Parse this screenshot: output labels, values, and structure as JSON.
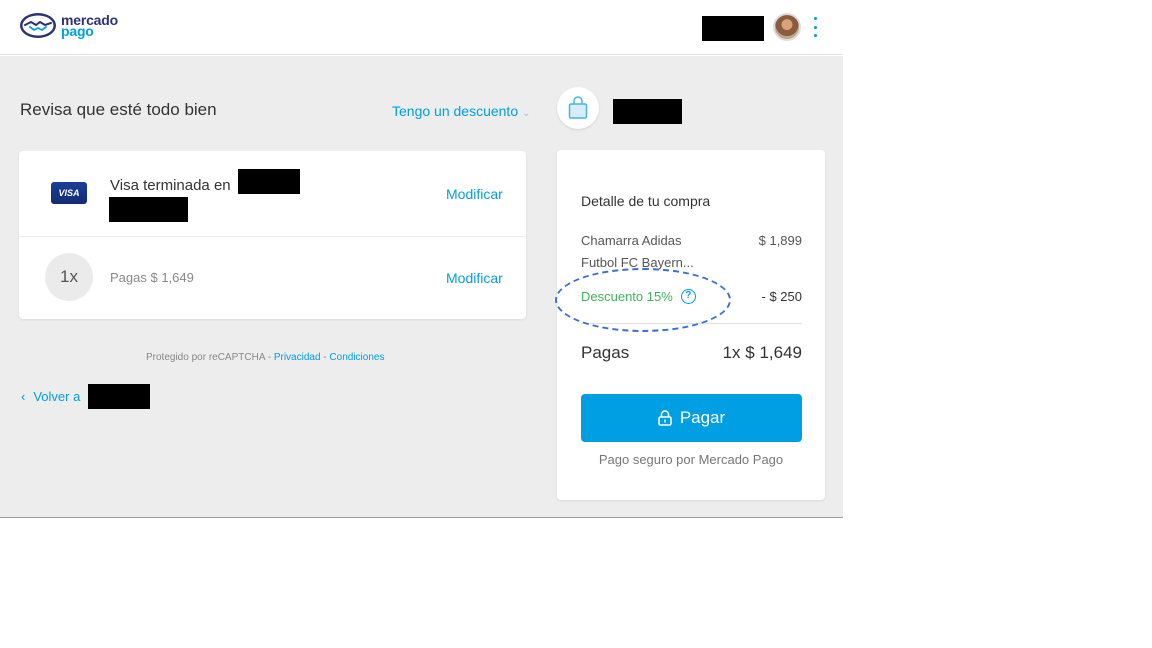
{
  "header": {
    "logo": {
      "line1": "mercado",
      "line2": "pago"
    }
  },
  "review": {
    "title": "Revisa que esté todo bien",
    "discount_link": "Tengo un descuento",
    "chevron": "⌄"
  },
  "payment_card": {
    "brand": "VISA",
    "card_text": "Visa terminada en",
    "modify_label": "Modificar",
    "installments": "1x",
    "installments_text": "Pagas $ 1,649",
    "modify_label_2": "Modificar"
  },
  "footer": {
    "protected_prefix": "Protegido por reCAPTCHA - ",
    "privacy": "Privacidad",
    "separator": " - ",
    "conditions": "Condiciones",
    "back_label": "Volver a",
    "back_chevron": "‹"
  },
  "summary": {
    "title": "Detalle de tu compra",
    "item_name": "Chamarra Adidas Futbol FC Bayern...",
    "item_price": "$ 1,899",
    "discount_label": "Descuento 15%",
    "help_symbol": "?",
    "discount_value": "- $ 250",
    "pay_label": "Pagas",
    "pay_total": "1x $ 1,649",
    "button_label": "Pagar",
    "secure_text": "Pago seguro por Mercado Pago"
  },
  "colors": {
    "accent": "#009ee3",
    "discount_green": "#3fb35a",
    "brand_navy": "#2d3277",
    "background_grey": "#ededed"
  },
  "icons": [
    "mercadopago-handshake-icon",
    "kebab-menu-icon",
    "chevron-down-icon",
    "visa-card-icon",
    "chevron-left-icon",
    "shopping-bag-icon",
    "help-circle-icon",
    "lock-icon"
  ]
}
